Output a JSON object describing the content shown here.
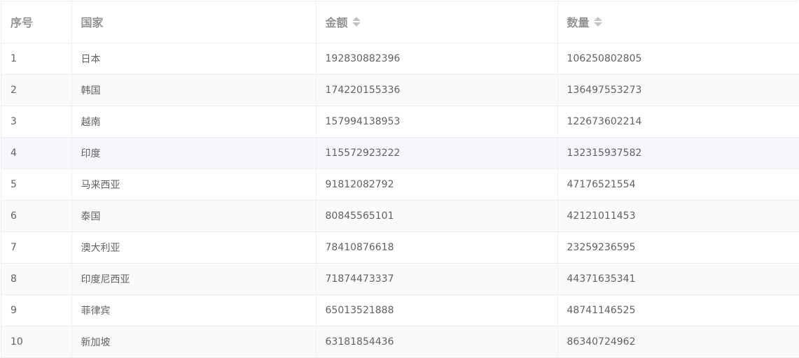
{
  "table": {
    "columns": [
      {
        "label": "序号",
        "sortable": false
      },
      {
        "label": "国家",
        "sortable": false
      },
      {
        "label": "金额",
        "sortable": true
      },
      {
        "label": "数量",
        "sortable": true
      }
    ],
    "rows": [
      {
        "index": "1",
        "country": "日本",
        "amount": "192830882396",
        "quantity": "106250802805"
      },
      {
        "index": "2",
        "country": "韩国",
        "amount": "174220155336",
        "quantity": "136497553273"
      },
      {
        "index": "3",
        "country": "越南",
        "amount": "157994138953",
        "quantity": "122673602214"
      },
      {
        "index": "4",
        "country": "印度",
        "amount": "115572923222",
        "quantity": "132315937582"
      },
      {
        "index": "5",
        "country": "马来西亚",
        "amount": "91812082792",
        "quantity": "47176521554"
      },
      {
        "index": "6",
        "country": "泰国",
        "amount": "80845565101",
        "quantity": "42121011453"
      },
      {
        "index": "7",
        "country": "澳大利亚",
        "amount": "78410876618",
        "quantity": "23259236595"
      },
      {
        "index": "8",
        "country": "印度尼西亚",
        "amount": "71874473337",
        "quantity": "44371635341"
      },
      {
        "index": "9",
        "country": "菲律宾",
        "amount": "65013521888",
        "quantity": "48741146525"
      },
      {
        "index": "10",
        "country": "新加坡",
        "amount": "63181854436",
        "quantity": "86340724962"
      }
    ]
  },
  "colors": {
    "header_text": "#909399",
    "cell_text": "#606266",
    "border": "#ebeef5",
    "stripe": "#fafafa",
    "hover_row": "#f5f7fa",
    "sort_icon": "#c0c4cc"
  },
  "icons": {
    "sort": "sort-caret-icon"
  }
}
